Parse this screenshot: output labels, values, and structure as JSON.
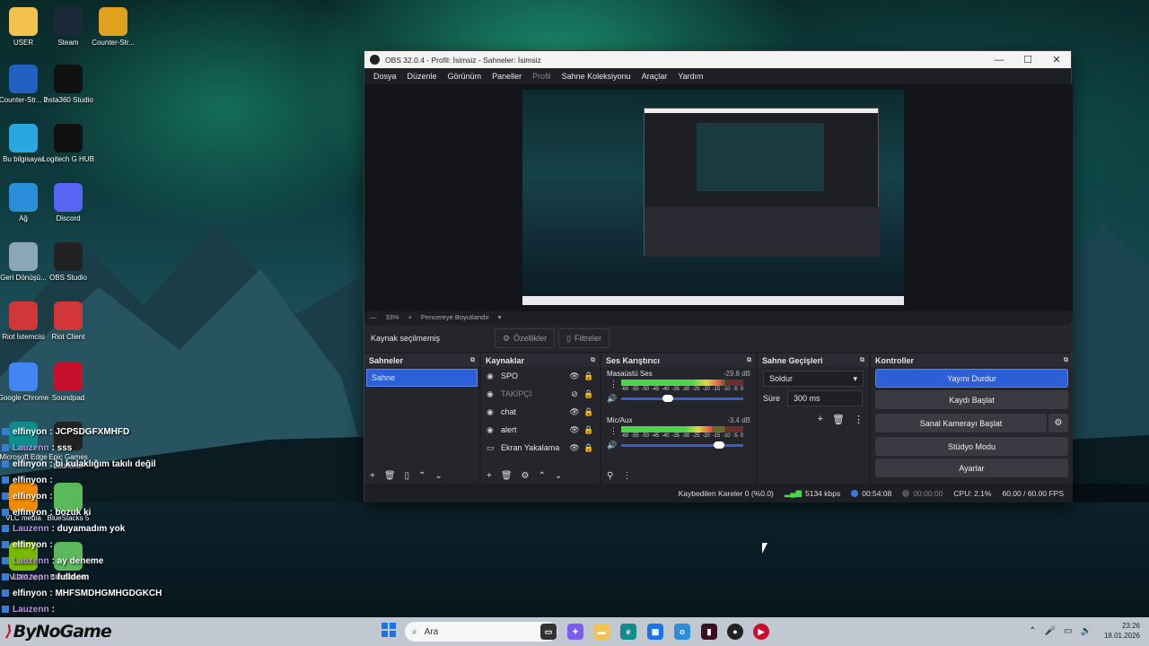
{
  "desktop": {
    "icons": [
      {
        "label": "USER",
        "icon": "folder-icon",
        "color": "#f2c14e"
      },
      {
        "label": "Steam",
        "icon": "steam-icon",
        "color": "#1b2838"
      },
      {
        "label": "Counter-Str...",
        "icon": "counter-strike-icon",
        "color": "#e0a020"
      },
      {
        "label": "Counter-Str... 2",
        "icon": "counter-strike-2-icon",
        "color": "#2060c0"
      },
      {
        "label": "Insta360 Studio",
        "icon": "insta360-icon",
        "color": "#111111"
      },
      {
        "label": "Bu bilgisayar",
        "icon": "computer-icon",
        "color": "#2aa6e0"
      },
      {
        "label": "Logitech G HUB",
        "icon": "logitech-icon",
        "color": "#111111"
      },
      {
        "label": "Ağ",
        "icon": "network-icon",
        "color": "#2a8fd8"
      },
      {
        "label": "Discord",
        "icon": "discord-icon",
        "color": "#5865f2"
      },
      {
        "label": "Geri Dönüşü...",
        "icon": "recycle-bin-icon",
        "color": "#8aa6b8"
      },
      {
        "label": "OBS Studio",
        "icon": "obs-icon",
        "color": "#222222"
      },
      {
        "label": "Riot İstemcisi",
        "icon": "riot-icon",
        "color": "#d13639"
      },
      {
        "label": "Riot Client",
        "icon": "riot-client-icon",
        "color": "#d13639"
      },
      {
        "label": "Google Chrome",
        "icon": "chrome-icon",
        "color": "#4285f4"
      },
      {
        "label": "Soundpad",
        "icon": "soundpad-icon",
        "color": "#c8102e"
      },
      {
        "label": "Microsoft Edge",
        "icon": "edge-icon",
        "color": "#0f8c8c"
      },
      {
        "label": "Epic Games Launcher",
        "icon": "epic-icon",
        "color": "#222222"
      },
      {
        "label": "VLC media",
        "icon": "vlc-icon",
        "color": "#f08a00"
      },
      {
        "label": "BlueStacks 5",
        "icon": "bluestacks-icon",
        "color": "#5bb85b"
      },
      {
        "label": "NVIDIA App",
        "icon": "nvidia-icon",
        "color": "#76b900"
      },
      {
        "label": "BlueStacks",
        "icon": "bluestacks-multi-icon",
        "color": "#5bb85b"
      }
    ]
  },
  "chat": [
    {
      "user": "elfinyon",
      "text": ": JCPSDGFXMHFD",
      "color": "#ffffff"
    },
    {
      "user": "Lauzenn",
      "text": ": sss",
      "color": "#c48cf0"
    },
    {
      "user": "elfinyon",
      "text": ": bi kulaklığım takılı değil",
      "color": "#ffffff"
    },
    {
      "user": "elfinyon",
      "text": ":",
      "color": "#ffffff"
    },
    {
      "user": "elfinyon",
      "text": ":",
      "color": "#ffffff"
    },
    {
      "user": "elfinyon",
      "text": ": bozuk ki",
      "color": "#ffffff"
    },
    {
      "user": "Lauzenn",
      "text": ": duyamadım yok",
      "color": "#c48cf0"
    },
    {
      "user": "elfinyon",
      "text": ":",
      "color": "#ffffff"
    },
    {
      "user": "Lauzenn",
      "text": ": ay deneme",
      "color": "#c48cf0"
    },
    {
      "user": "Lauzenn",
      "text": ": fulldem",
      "color": "#c48cf0"
    },
    {
      "user": "elfinyon",
      "text": ": MHFSMDHGMHGDGKCH",
      "color": "#ffffff"
    },
    {
      "user": "Lauzenn",
      "text": ":",
      "color": "#c48cf0"
    }
  ],
  "obs": {
    "title": "OBS 32.0.4 - Profil: İsimsiz - Sahneler: İsimsiz",
    "window_controls": {
      "minimize": "—",
      "maximize": "☐",
      "close": "✕"
    },
    "menu": [
      {
        "label": "Dosya",
        "enabled": true
      },
      {
        "label": "Düzenle",
        "enabled": true
      },
      {
        "label": "Görünüm",
        "enabled": true
      },
      {
        "label": "Paneller",
        "enabled": true
      },
      {
        "label": "Profil",
        "enabled": false
      },
      {
        "label": "Sahne Koleksiyonu",
        "enabled": true
      },
      {
        "label": "Araçlar",
        "enabled": true
      },
      {
        "label": "Yardım",
        "enabled": true
      }
    ],
    "preview_toolbar": {
      "minus": "—",
      "zoom": "33%",
      "plus": "+",
      "fit": "Pencereye Boyutlandır",
      "dropdown": "▾"
    },
    "context": {
      "label": "Kaynak seçilmemiş",
      "properties": "Özellikler",
      "filters": "Filtreler"
    },
    "scenes": {
      "title": "Sahneler",
      "items": [
        "Sahne"
      ]
    },
    "sources": {
      "title": "Kaynaklar",
      "items": [
        {
          "name": "SPO",
          "visible": true
        },
        {
          "name": "TAKİPÇİ",
          "visible": false
        },
        {
          "name": "chat",
          "visible": true
        },
        {
          "name": "alert",
          "visible": true
        },
        {
          "name": "Ekran Yakalama",
          "visible": true
        }
      ]
    },
    "mixer": {
      "title": "Ses Karıştırıcı",
      "channels": [
        {
          "name": "Masaüstü Ses",
          "db": "-29.8 dB",
          "level": 0.82,
          "volume": 0.38
        },
        {
          "name": "Mic/Aux",
          "db": "-3.4 dB",
          "level": 0.74,
          "volume": 0.8
        }
      ],
      "ticks": [
        "-60",
        "-55",
        "-50",
        "-45",
        "-40",
        "-35",
        "-30",
        "-25",
        "-20",
        "-15",
        "-10",
        "-5",
        "0"
      ]
    },
    "transitions": {
      "title": "Sahne Geçişleri",
      "type": "Soldur",
      "duration_label": "Süre",
      "duration": "300 ms"
    },
    "controls": {
      "title": "Kontroller",
      "buttons": [
        "Yayını Durdur",
        "Kaydı Başlat",
        "Sanal Kamerayı Başlat",
        "Stüdyo Modu",
        "Ayarlar"
      ]
    },
    "status": {
      "dropped": "Kaybedilen Kareler 0 (%0.0)",
      "bitrate": "5134 kbps",
      "stream_time": "00:54:08",
      "record_time": "00:00:00",
      "cpu": "CPU: 2.1%",
      "fps": "60.00 / 60.00 FPS"
    }
  },
  "taskbar": {
    "brand": "ByNoGame",
    "search_placeholder": "Ara",
    "time": "23:26",
    "date": "18.01.2026"
  }
}
